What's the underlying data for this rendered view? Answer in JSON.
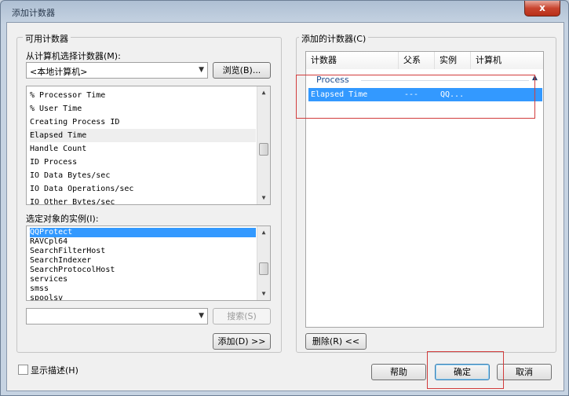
{
  "window": {
    "title": "添加计数器",
    "close_label": "x"
  },
  "available": {
    "group_label": "可用计数器",
    "select_label": "从计算机选择计数器(M):",
    "computer_value": "<本地计算机>",
    "browse_button": "浏览(B)...",
    "counters": [
      "% Processor Time",
      "% User Time",
      "Creating Process ID",
      "Elapsed Time",
      "Handle Count",
      "ID Process",
      "IO Data Bytes/sec",
      "IO Data Operations/sec",
      "IO Other Bytes/sec"
    ],
    "instances_label": "选定对象的实例(I):",
    "instances": [
      "QQProtect",
      "RAVCpl64",
      "SearchFilterHost",
      "SearchIndexer",
      "SearchProtocolHost",
      "services",
      "smss",
      "spoolsv"
    ],
    "search_value": "",
    "search_button": "搜索(S)",
    "add_button": "添加(D) >>"
  },
  "added": {
    "group_label": "添加的计数器(C)",
    "columns": [
      "计数器",
      "父系",
      "实例",
      "计算机"
    ],
    "category": "Process",
    "rows": [
      {
        "counter": "Elapsed Time",
        "parent": "---",
        "instance": "QQ...",
        "computer": ""
      }
    ],
    "remove_button": "删除(R) <<"
  },
  "footer": {
    "show_description": "显示描述(H)",
    "help_button": "帮助",
    "ok_button": "确定",
    "cancel_button": "取消"
  }
}
